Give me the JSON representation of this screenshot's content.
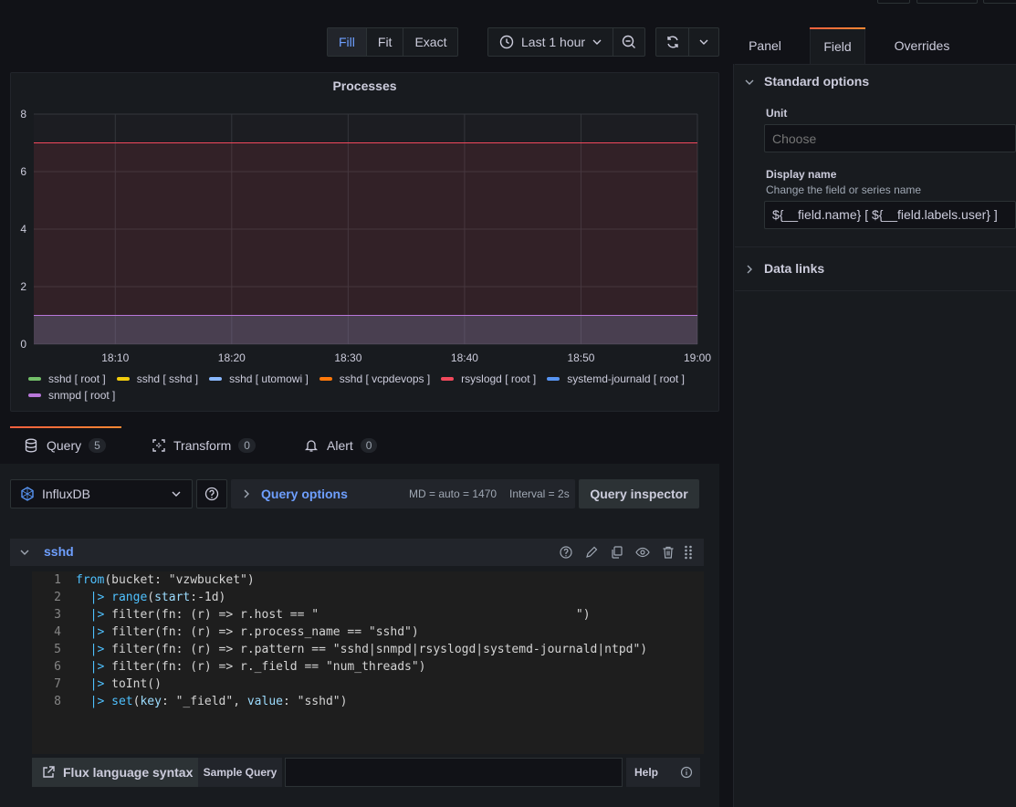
{
  "toolbar": {
    "fill": "Fill",
    "fit": "Fit",
    "exact": "Exact",
    "time_range": "Last 1 hour"
  },
  "panel": {
    "title": "Processes"
  },
  "chart_data": {
    "type": "area",
    "title": "Processes",
    "xlabel": "",
    "ylabel": "",
    "x": [
      "18:10",
      "18:20",
      "18:30",
      "18:40",
      "18:50",
      "19:00"
    ],
    "x_range": [
      "18:03",
      "19:00"
    ],
    "ylim": [
      0,
      8
    ],
    "y_ticks": [
      0,
      2,
      4,
      6,
      8
    ],
    "grid": true,
    "legend_position": "bottom",
    "series": [
      {
        "name": "sshd [ root ]",
        "color": "#73bf69",
        "values": [
          1,
          1,
          1,
          1,
          1,
          1
        ]
      },
      {
        "name": "sshd [ sshd ]",
        "color": "#f2cc0c",
        "values": [
          0,
          0,
          0,
          0,
          0,
          0
        ]
      },
      {
        "name": "sshd [ utomowi ]",
        "color": "#8ab8ff",
        "values": [
          0,
          0,
          0,
          0,
          0,
          0
        ]
      },
      {
        "name": "sshd [ vcpdevops ]",
        "color": "#ff780a",
        "values": [
          0,
          0,
          0,
          0,
          0,
          0
        ]
      },
      {
        "name": "rsyslogd [ root ]",
        "color": "#f2495c",
        "values": [
          7,
          7,
          7,
          7,
          7,
          7
        ]
      },
      {
        "name": "systemd-journald [ root ]",
        "color": "#5794f2",
        "values": [
          1,
          1,
          1,
          1,
          1,
          1
        ]
      },
      {
        "name": "snmpd [ root ]",
        "color": "#b877d9",
        "values": [
          1,
          1,
          1,
          1,
          1,
          1
        ]
      }
    ]
  },
  "query_tabs": [
    {
      "label": "Query",
      "count": "5"
    },
    {
      "label": "Transform",
      "count": "0"
    },
    {
      "label": "Alert",
      "count": "0"
    }
  ],
  "datasource": {
    "name": "InfluxDB"
  },
  "query_options": {
    "label": "Query options",
    "md": "MD = auto = 1470",
    "interval": "Interval = 2s",
    "inspector": "Query inspector"
  },
  "query_row": {
    "name": "sshd"
  },
  "code": [
    "from(bucket: \"vzwbucket\")",
    "  |> range(start:-1d)",
    "  |> filter(fn: (r) => r.host == \"                                    \")",
    "  |> filter(fn: (r) => r.process_name == \"sshd\")",
    "  |> filter(fn: (r) => r.pattern == \"sshd|snmpd|rsyslogd|systemd-journald|ntpd\")",
    "  |> filter(fn: (r) => r._field == \"num_threads\")",
    "  |> toInt()",
    "  |> set(key: \"_field\", value: \"sshd\")"
  ],
  "editor_footer": {
    "flux_syntax": "Flux language syntax",
    "sample_query": "Sample Query",
    "help": "Help"
  },
  "side": {
    "tabs": [
      "Panel",
      "Field",
      "Overrides"
    ],
    "standard_options": "Standard options",
    "unit_label": "Unit",
    "unit_placeholder": "Choose",
    "display_name_label": "Display name",
    "display_name_desc": "Change the field or series name",
    "display_name_value": "${__field.name} [ ${__field.labels.user} ]",
    "data_links": "Data links"
  }
}
